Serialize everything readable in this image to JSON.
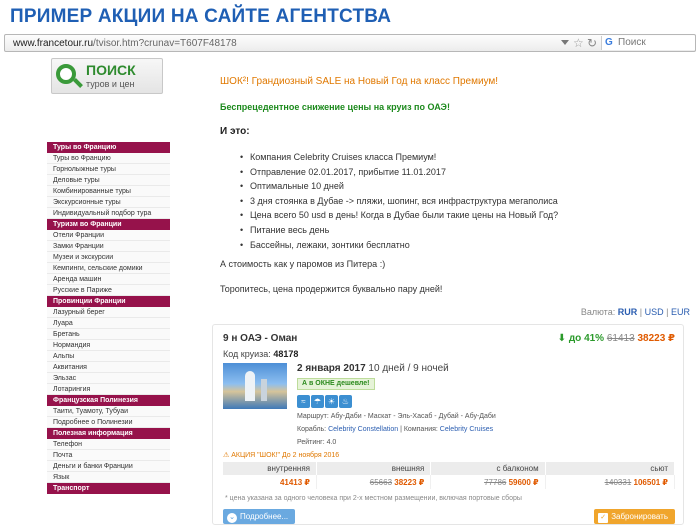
{
  "slide": {
    "title": "ПРИМЕР АКЦИИ НА САЙТЕ АГЕНТСТВА"
  },
  "browser": {
    "url_host": "www.francetour.ru",
    "url_path": "/tvisor.htm?crunav=T607F48178",
    "search_placeholder": "Поиск",
    "search_engine_glyph": "G"
  },
  "logo": {
    "line1": "ПОИСК",
    "line2": "туров и цен"
  },
  "sidebar": {
    "sections": [
      {
        "title": "Туры во Францию",
        "items": [
          "Туры во Францию",
          "Горнолыжные туры",
          "Деловые туры",
          "Комбинированные туры",
          "Экскурсионные туры",
          "Индивидуальный подбор тура"
        ]
      },
      {
        "title": "Туризм во Франции",
        "items": [
          "Отели Франции",
          "Замки Франции",
          "Музеи и экскурсии",
          "Кемпинги, сельские домики",
          "Аренда машин",
          "Русские в Париже"
        ]
      },
      {
        "title": "Провинции Франции",
        "items": [
          "Лазурный берег",
          "Луара",
          "Бретань",
          "Нормандия",
          "Альпы",
          "Аквитания",
          "Эльзас",
          "Лотарингия"
        ]
      },
      {
        "title": "Французская Полинезия",
        "items": [
          "Таити, Туамоту, Тубуаи",
          "Подробнее о Полинезии"
        ]
      },
      {
        "title": "Полезная информация",
        "items": [
          "Телефон",
          "Почта",
          "Деньги и банки Франции",
          "Язык"
        ]
      },
      {
        "title": "Транспорт",
        "items": []
      }
    ]
  },
  "content": {
    "headline": "ШОК²! Грандиозный SALE на Новый Год на класс Премиум!",
    "subheadline": "Беспрецедентное снижение цены на круиз по ОАЭ!",
    "and_this": "И это:",
    "bullets": [
      "Компания Celebrity Cruises класса Премиум!",
      "Отправление 02.01.2017, прибытие 11.01.2017",
      "Оптимальные 10 дней",
      "3 дня стоянка в Дубае -> пляжи, шопинг, вся инфраструктура мегаполиса",
      "Цена всего 50 usd в день! Когда в Дубае были такие цены на Новый Год?",
      "Питание весь день",
      "Бассейны, лежаки, зонтики бесплатно"
    ],
    "para1": "А стоимость как у паромов из Питера :)",
    "para2": "Торопитесь, цена продержится буквально пару дней!"
  },
  "currency": {
    "label": "Валюта:",
    "options": [
      "RUR",
      "USD",
      "EUR"
    ],
    "separator": "|",
    "active": "RUR"
  },
  "card": {
    "title": "9 н ОАЭ - Оман",
    "code_label": "Код круиза:",
    "code": "48178",
    "price_arrow": "⬇",
    "discount": "до 41%",
    "price_old": "61413",
    "price_new": "38223 ₽",
    "date": "2 января 2017",
    "duration": "10 дней / 9 ночей",
    "okno_badge": "А в ОКНЕ дешевле!",
    "feature_icons": [
      "pool-icon",
      "beach-icon",
      "sun-icon",
      "drink-icon"
    ],
    "feature_glyphs": [
      "≈",
      "☂",
      "☀",
      "♨"
    ],
    "route": "Маршрут: Абу-Даби - Маскат - Эль-Хасаб - Дубай - Абу-Даби",
    "ship_label": "Корабль:",
    "ship": "Celebrity Constellation",
    "company_label": "Компания:",
    "company": "Celebrity Cruises",
    "rating": "Рейтинг: 4.0",
    "promo": "⚠ АКЦИЯ \"ШОК!\" До 2 ноября 2016",
    "table": {
      "headers": [
        "внутренняя",
        "внешняя",
        "с балконом",
        "сьют"
      ],
      "rows": [
        {
          "old": "",
          "new": "41413 ₽"
        },
        {
          "old": "65663",
          "new": "38223 ₽"
        },
        {
          "old": "77786",
          "new": "59600 ₽"
        },
        {
          "old": "140331",
          "new": "106501 ₽"
        }
      ]
    },
    "note": "* цена указана за одного человека при 2-х местном размещении, включая портовые сборы",
    "btn_more": "Подробнее...",
    "btn_more_icon": "⌄",
    "btn_book": "Забронировать",
    "btn_book_icon": "✓"
  },
  "colors": {
    "menu_head": "#96124b",
    "accent_orange": "#e07800",
    "accent_green": "#1d8a1d",
    "link": "#2a5db0"
  }
}
